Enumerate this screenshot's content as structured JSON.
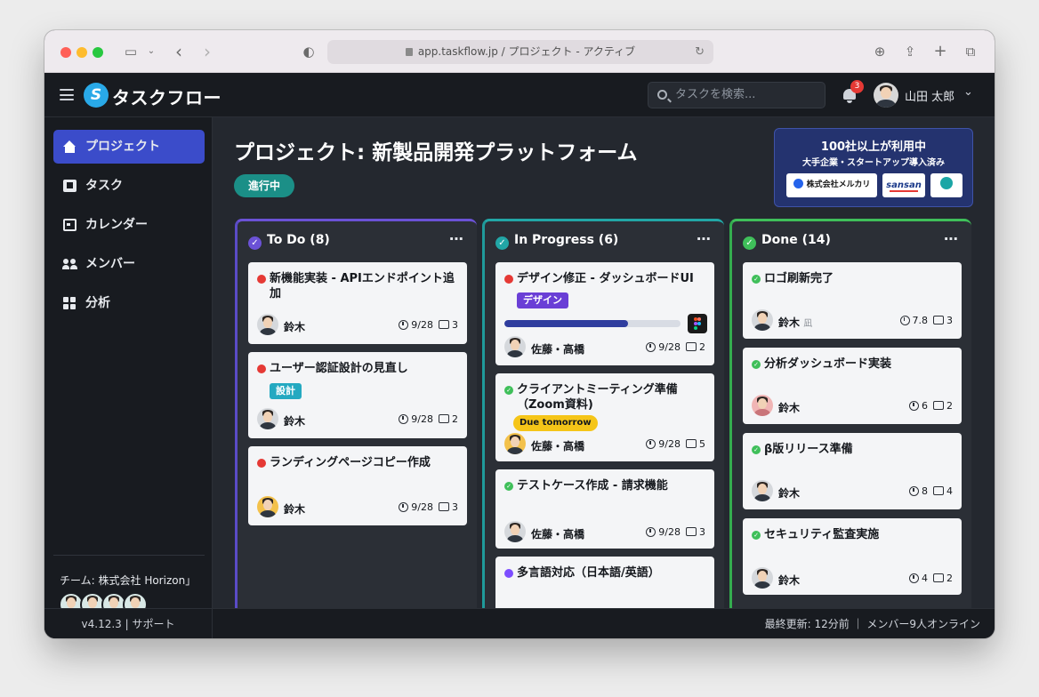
{
  "browser": {
    "url": "app.taskflow.jp / プロジェクト - アクティブ"
  },
  "header": {
    "app_name": "タスクフロー",
    "search_placeholder": "タスクを検索...",
    "notification_count": "3",
    "user_name": "山田 太郎"
  },
  "sidebar": {
    "items": [
      {
        "label": "プロジェクト",
        "icon": "home-icon",
        "active": true
      },
      {
        "label": "タスク",
        "icon": "task-icon",
        "active": false
      },
      {
        "label": "カレンダー",
        "icon": "calendar-icon",
        "active": false
      },
      {
        "label": "メンバー",
        "icon": "members-icon",
        "active": false
      },
      {
        "label": "分析",
        "icon": "analytics-icon",
        "active": false
      }
    ],
    "team_label": "チーム: 株式会社 Horizon」"
  },
  "main": {
    "title": "プロジェクト: 新製品開発プラットフォーム",
    "status": "進行中",
    "banner": {
      "headline": "100社以上が利用中",
      "subline": "大手企業・スタートアップ導入済み",
      "logo1": "株式会社メルカリ",
      "logo2": "sansan",
      "logo3": "Ǝ"
    }
  },
  "columns": [
    {
      "title": "To Do (8)",
      "accent": "#6b52d6",
      "cards": [
        {
          "title": "新機能実装 - APIエンドポイント追加",
          "assignee": "鈴木",
          "due": "9/28",
          "comments": "3"
        },
        {
          "title": "ユーザー認証設計の見直し",
          "tag": "設計",
          "assignee": "鈴木",
          "due": "9/28",
          "comments": "2"
        },
        {
          "title": "ランディングページコピー作成",
          "assignee": "鈴木",
          "due": "9/28",
          "comments": "3"
        }
      ]
    },
    {
      "title": "In Progress (6)",
      "accent": "#22a6a6",
      "cards": [
        {
          "title": "デザイン修正 - ダッシュボードUI",
          "tag": "デザイン",
          "progress": 0.7,
          "assignee": "佐藤・高橋",
          "due": "9/28",
          "comments": "2"
        },
        {
          "title": "クライアントミーティング準備（Zoom資料)",
          "tag": "Due tomorrow",
          "assignee": "佐藤・高橋",
          "due": "9/28",
          "comments": "5"
        },
        {
          "title": "テストケース作成 - 請求機能",
          "assignee": "佐藤・高橋",
          "due": "9/28",
          "comments": "3"
        },
        {
          "title": "多言語対応（日本語/英語）"
        }
      ]
    },
    {
      "title": "Done (14)",
      "accent": "#3fbf5a",
      "cards": [
        {
          "title": "ロゴ刷新完了",
          "assignee": "鈴木",
          "assignee_extra": "凪",
          "due": "7.8",
          "comments": "3"
        },
        {
          "title": "分析ダッシュボード実装",
          "assignee": "鈴木",
          "due": "6",
          "comments": "2"
        },
        {
          "title": "β版リリース準備",
          "assignee": "鈴木",
          "due": "8",
          "comments": "4"
        },
        {
          "title": "セキュリティ監査実施",
          "assignee": "鈴木",
          "due": "4",
          "comments": "2"
        }
      ]
    }
  ],
  "footer": {
    "version": "v4.12.3 | サポート",
    "status": "最終更新: 12分前 ｜ メンバー9人オンライン"
  }
}
